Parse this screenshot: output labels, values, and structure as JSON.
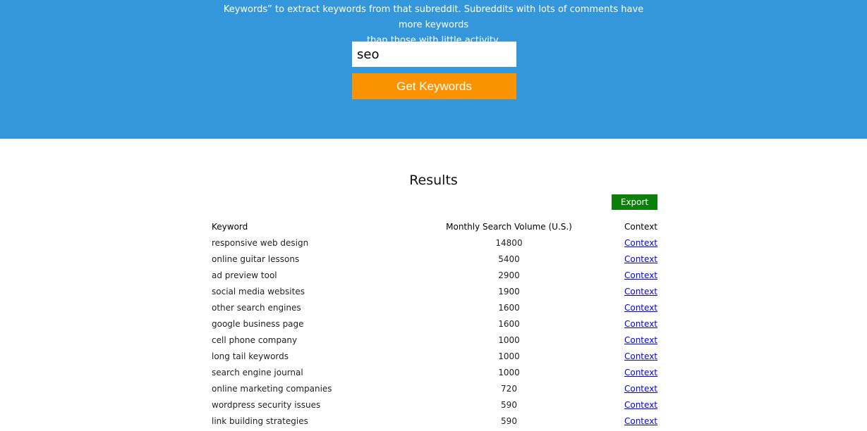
{
  "hero": {
    "intro_line1": "Keywords” to extract keywords from that subreddit. Subreddits with lots of comments have more keywords",
    "intro_line2": "than those with little activity.",
    "search_value": "seo",
    "button_label": "Get Keywords"
  },
  "results": {
    "title": "Results",
    "export_label": "Export",
    "headers": {
      "keyword": "Keyword",
      "volume": "Monthly Search Volume (U.S.)",
      "context": "Context"
    },
    "rows": [
      {
        "keyword": "responsive web design",
        "volume": "14800",
        "context": "Context"
      },
      {
        "keyword": "online guitar lessons",
        "volume": "5400",
        "context": "Context"
      },
      {
        "keyword": "ad preview tool",
        "volume": "2900",
        "context": "Context"
      },
      {
        "keyword": "social media websites",
        "volume": "1900",
        "context": "Context"
      },
      {
        "keyword": "other search engines",
        "volume": "1600",
        "context": "Context"
      },
      {
        "keyword": "google business page",
        "volume": "1600",
        "context": "Context"
      },
      {
        "keyword": "cell phone company",
        "volume": "1000",
        "context": "Context"
      },
      {
        "keyword": "long tail keywords",
        "volume": "1000",
        "context": "Context"
      },
      {
        "keyword": "search engine journal",
        "volume": "1000",
        "context": "Context"
      },
      {
        "keyword": "online marketing companies",
        "volume": "720",
        "context": "Context"
      },
      {
        "keyword": "wordpress security issues",
        "volume": "590",
        "context": "Context"
      },
      {
        "keyword": "link building strategies",
        "volume": "590",
        "context": "Context"
      }
    ]
  },
  "colors": {
    "hero_background": "#3497dc",
    "get_keywords_button": "#fb9300",
    "export_button": "#0a7f0a",
    "link": "#0000ee"
  }
}
